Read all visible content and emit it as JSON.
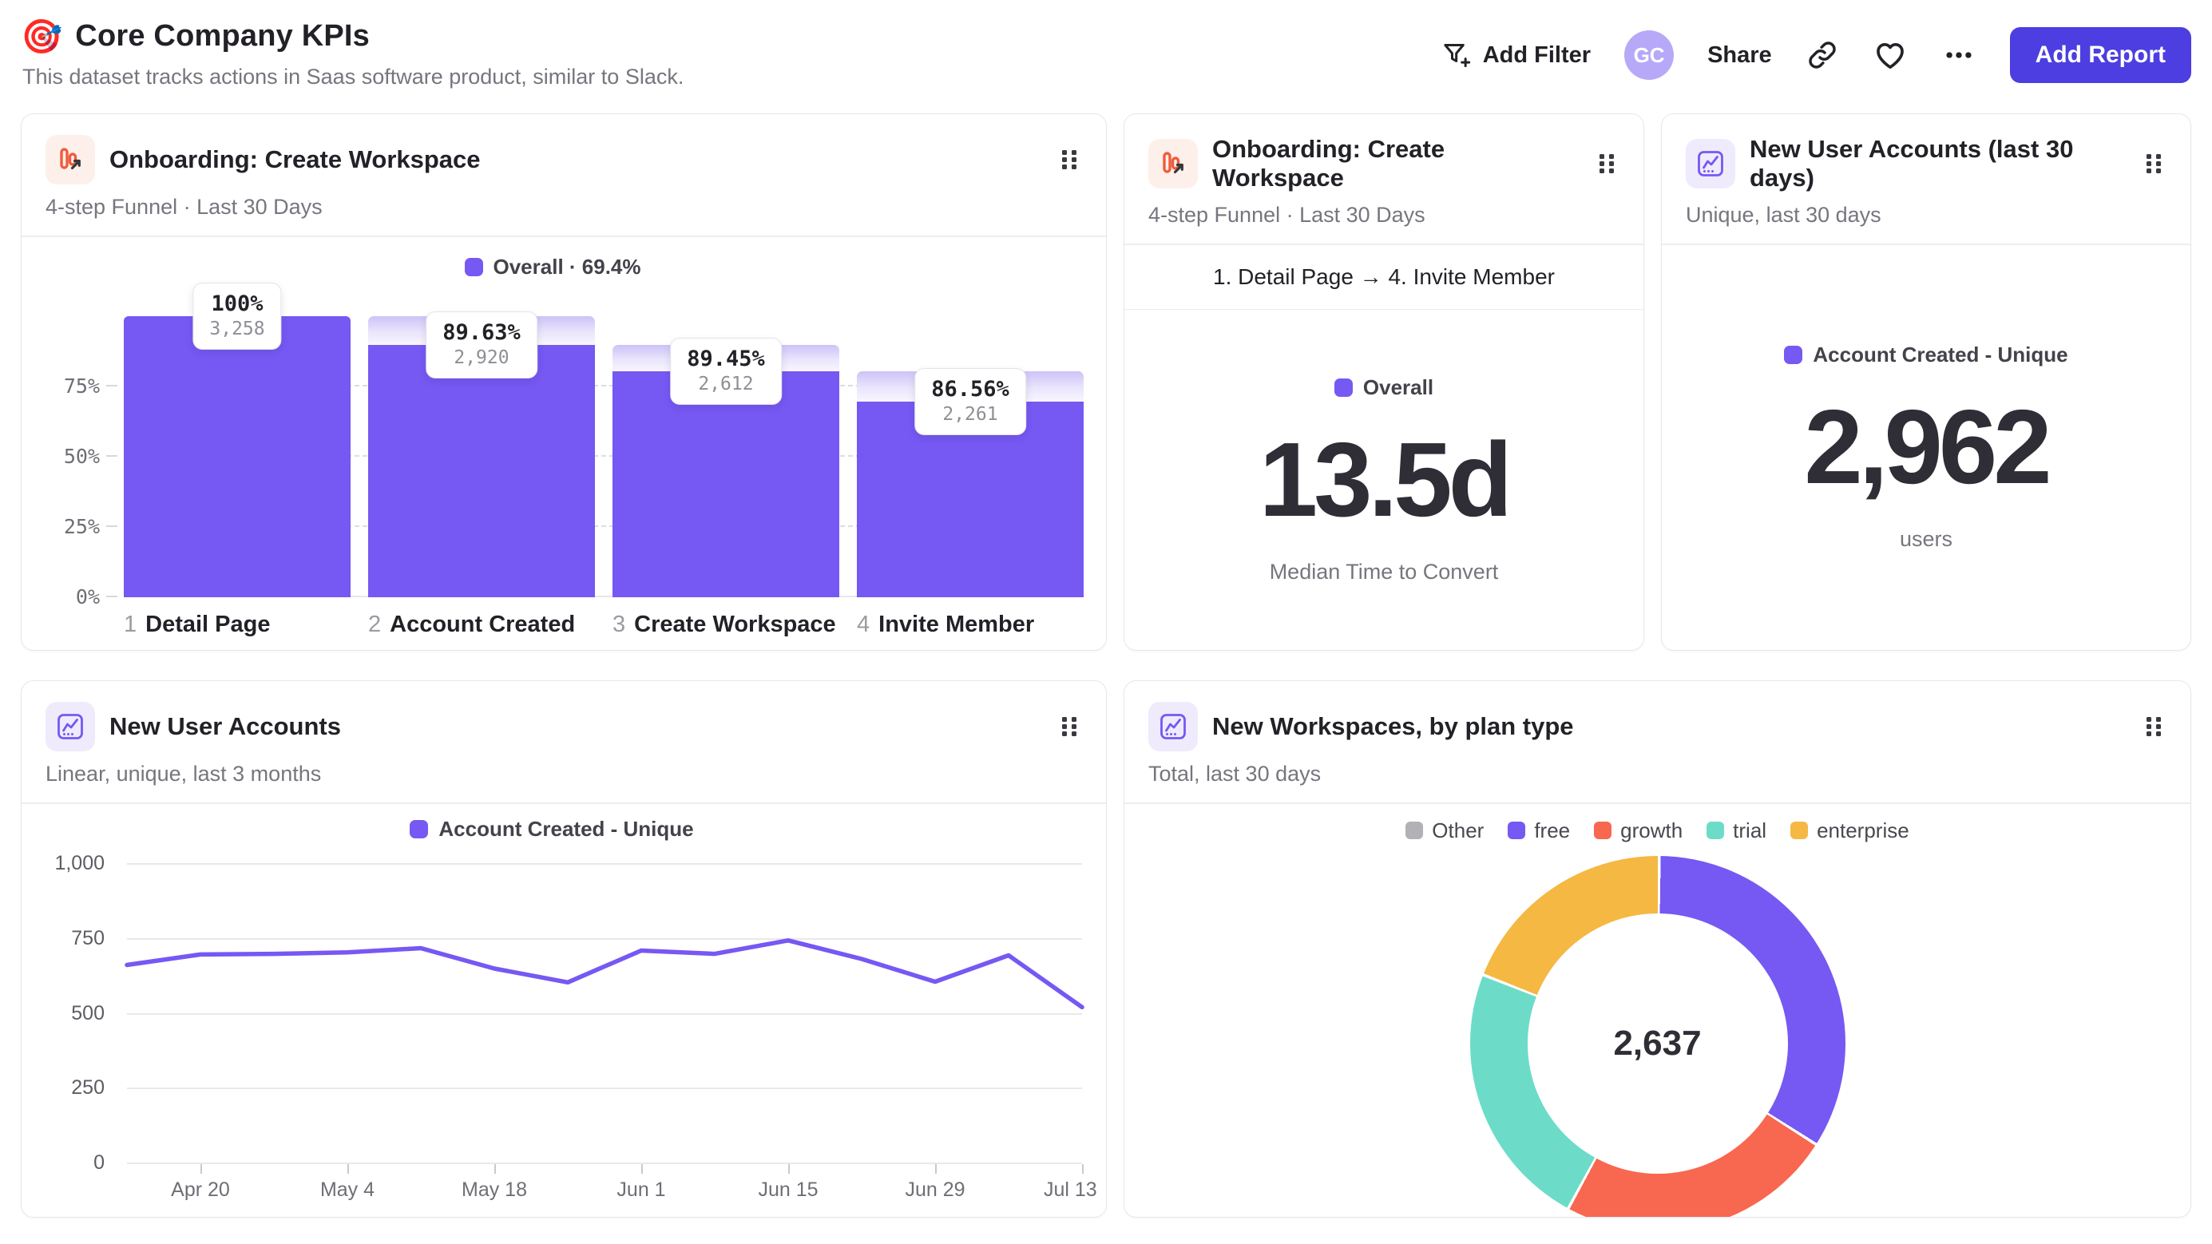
{
  "header": {
    "emoji": "🎯",
    "title": "Core Company KPIs",
    "subtitle": "This dataset tracks actions in Saas software product, similar to Slack."
  },
  "toolbar": {
    "add_filter_label": "Add Filter",
    "avatar_initials": "GC",
    "share_label": "Share",
    "add_report_label": "Add Report"
  },
  "colors": {
    "accent_purple": "#7658f3",
    "button_indigo": "#4c3ee0",
    "coral": "#f8674f",
    "teal": "#6cdcc8",
    "yellow": "#f4b843",
    "legend_gray": "#b1b1b6",
    "avatar_bg": "#b7a9f8"
  },
  "cards": {
    "funnel": {
      "title": "Onboarding: Create Workspace",
      "subtitle": "4-step Funnel · Last 30 Days",
      "legend_label": "Overall · 69.4%"
    },
    "time_to_convert": {
      "title": "Onboarding: Create Workspace",
      "subtitle": "4-step Funnel · Last 30 Days",
      "range_label": "1. Detail Page → 4. Invite Member",
      "legend_label": "Overall",
      "value": "13.5d",
      "caption": "Median Time to Convert"
    },
    "new_accounts_30d": {
      "title": "New User Accounts (last 30 days)",
      "subtitle": "Unique, last 30 days",
      "legend_label": "Account Created - Unique",
      "value": "2,962",
      "caption": "users"
    },
    "accounts_trend": {
      "title": "New User Accounts",
      "subtitle": "Linear, unique, last 3 months",
      "legend_label": "Account Created - Unique"
    },
    "workspaces_by_plan": {
      "title": "New Workspaces, by plan type",
      "subtitle": "Total, last 30 days"
    }
  },
  "chart_data": [
    {
      "type": "bar",
      "variant": "funnel",
      "title": "Onboarding: Create Workspace",
      "legend": "Overall · 69.4%",
      "overall_conversion_pct": 69.4,
      "ylim": [
        0,
        100
      ],
      "y_ticks": [
        "75%",
        "50%",
        "25%",
        "0%"
      ],
      "steps": [
        {
          "n": "1",
          "label": "Detail Page",
          "pct_label": "100%",
          "count": 3258,
          "count_label": "3,258",
          "bar_pct": 100
        },
        {
          "n": "2",
          "label": "Account Created",
          "pct_label": "89.63%",
          "count": 2920,
          "count_label": "2,920",
          "bar_pct": 89.63
        },
        {
          "n": "3",
          "label": "Create Workspace",
          "pct_label": "89.45%",
          "count": 2612,
          "count_label": "2,612",
          "bar_pct": 80.17
        },
        {
          "n": "4",
          "label": "Invite Member",
          "pct_label": "86.56%",
          "count": 2261,
          "count_label": "2,261",
          "bar_pct": 69.4
        }
      ]
    },
    {
      "type": "line",
      "title": "New User Accounts",
      "legend": "Account Created - Unique",
      "x": [
        "Apr 13",
        "Apr 20",
        "Apr 27",
        "May 4",
        "May 11",
        "May 18",
        "May 25",
        "Jun 1",
        "Jun 8",
        "Jun 15",
        "Jun 22",
        "Jun 29",
        "Jul 6",
        "Jul 13"
      ],
      "x_tick_labels": [
        "Apr 20",
        "May 4",
        "May 18",
        "Jun 1",
        "Jun 15",
        "Jun 29",
        "Jul 13"
      ],
      "x_tick_start": 1,
      "x_tick_every": 2,
      "series": [
        {
          "name": "Account Created - Unique",
          "color": "#7658f3",
          "values": [
            668,
            703,
            705,
            710,
            724,
            656,
            610,
            716,
            705,
            750,
            688,
            612,
            700,
            527
          ]
        }
      ],
      "ylim": [
        0,
        1000
      ],
      "y_ticks": [
        1000,
        750,
        500,
        250,
        0
      ],
      "y_tick_labels": [
        "1,000",
        "750",
        "500",
        "250",
        "0"
      ],
      "grid": true,
      "legend_position": "top"
    },
    {
      "type": "pie",
      "title": "New Workspaces, by plan type",
      "total": 2637,
      "center_label": "2,637",
      "legend_position": "top",
      "slices": [
        {
          "label": "Other",
          "value": 0,
          "color": "#b1b1b6"
        },
        {
          "label": "free",
          "value": 894,
          "color": "#7658f3"
        },
        {
          "label": "growth",
          "value": 630,
          "color": "#f8674f"
        },
        {
          "label": "trial",
          "value": 608,
          "color": "#6cdcc8"
        },
        {
          "label": "enterprise",
          "value": 505,
          "color": "#f4b843"
        }
      ]
    }
  ]
}
